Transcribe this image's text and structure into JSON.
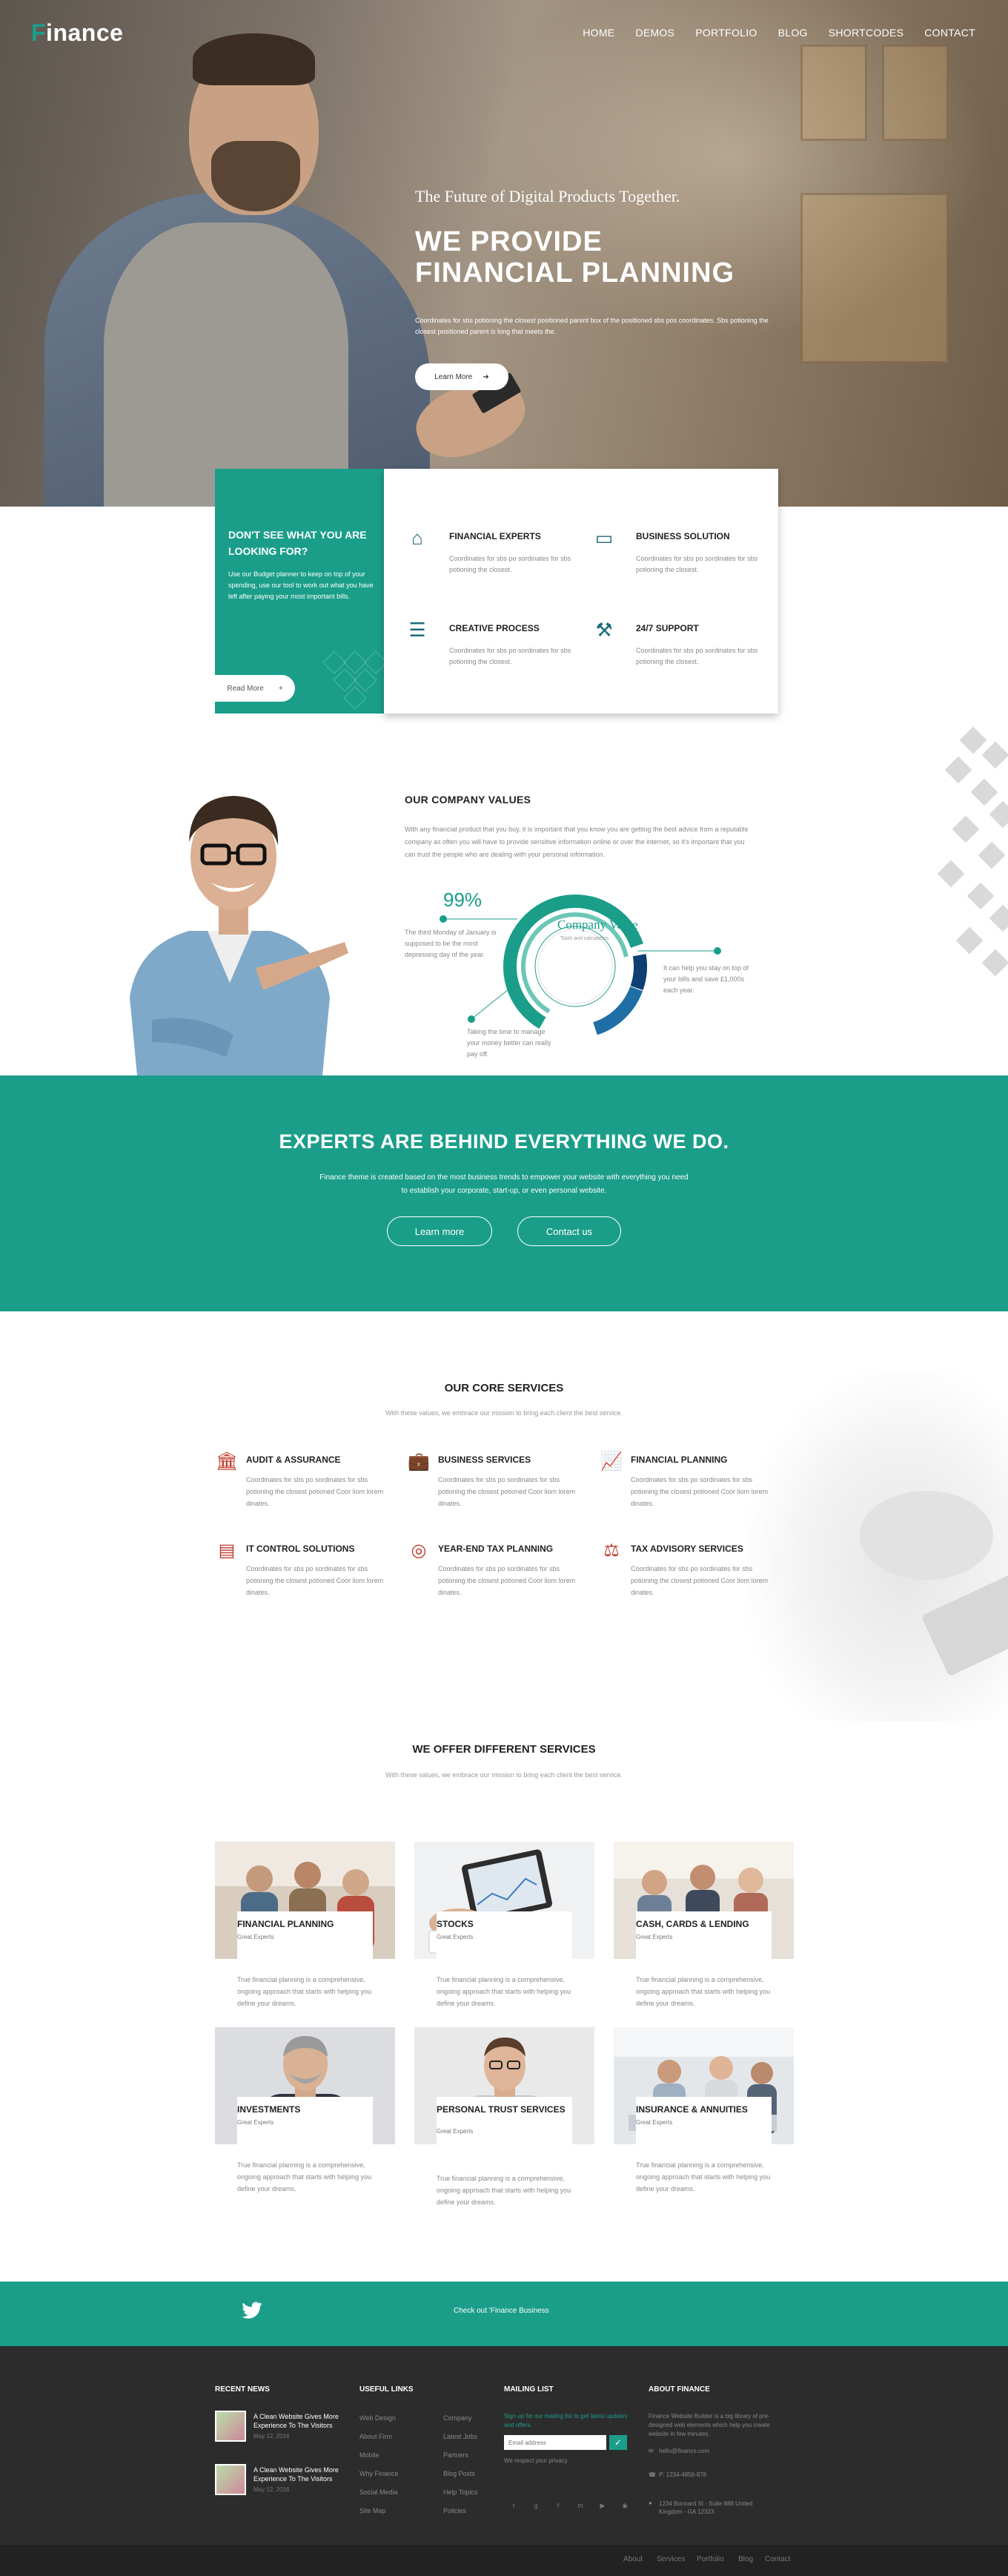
{
  "colors": {
    "accent": "#1a9e8a",
    "footer": "#2c2c2c"
  },
  "header": {
    "logo": "Finance",
    "nav": [
      "HOME",
      "DEMOS",
      "PORTFOLIO",
      "BLOG",
      "SHORTCODES",
      "CONTACT"
    ]
  },
  "hero": {
    "kicker": "The Future of Digital Products Together.",
    "title_line1": "WE PROVIDE",
    "title_line2": "FINANCIAL PLANNING",
    "text": "Coordinates for sbs potioning the closest positioned parent box of the positioned sbs pos coordinates. Sbs potioning the closest positioned parent is long that meets the.",
    "button": "Learn More"
  },
  "feature_box": {
    "title": "DON'T SEE WHAT YOU ARE LOOKING FOR?",
    "text": "Use our Budget planner to keep on top of your spending, use our tool to work out what you have left after paying your most important bills.",
    "button": "Read More",
    "items": [
      {
        "icon": "house-icon",
        "title": "FINANCIAL EXPERTS",
        "text": "Coordinates for sbs po sordinates for sbs potioning the closest."
      },
      {
        "icon": "business-icon",
        "title": "BUSINESS SOLUTION",
        "text": "Coordinates for sbs po sordinates for sbs potioning the closest."
      },
      {
        "icon": "sliders-icon",
        "title": "CREATIVE PROCESS",
        "text": "Coordinates for sbs po sordinates for sbs potioning the closest."
      },
      {
        "icon": "tools-icon",
        "title": "24/7 SUPPORT",
        "text": "Coordinates for sbs po sordinates for sbs potioning the closest."
      }
    ]
  },
  "values": {
    "title": "OUR COMPANY VALUES",
    "text": "With any financial product that you buy, it is important that you know you are getting the best advice from a reputable company as often you will have to provide sensitive information online or over the internet, so it's important that you can trust the people who are dealing with your personal information.",
    "percent": "99%",
    "chart_title": "Company Value",
    "chart_sub": "Tools and calculators",
    "label1": "The third Monday of January is supposed to be the most depressing day of the year.",
    "label2": "Taking the time to manage your money better can really pay off.",
    "label3": "It can help you stay on top of your bills and save £1,000s each year."
  },
  "experts": {
    "title": "EXPERTS ARE BEHIND EVERYTHING WE DO.",
    "text": "Finance theme is created based on the most business trends to empower your website with everything you need to establish your corporate, start-up, or even personal website.",
    "btn_learn": "Learn more",
    "btn_contact": "Contact us"
  },
  "core": {
    "title": "OUR CORE SERVICES",
    "subtitle": "With these values, we embrace our mission to bring each client the best service.",
    "items": [
      {
        "icon": "bank-icon",
        "title": "AUDIT & ASSURANCE",
        "text": "Coordinates for sbs po sordinates for sbs potioning the closest potioned Coor liom lorem dinates."
      },
      {
        "icon": "briefcase-icon",
        "title": "BUSINESS SERVICES",
        "text": "Coordinates for sbs po sordinates for sbs potioning the closest potioned Coor liom lorem dinates."
      },
      {
        "icon": "chart-icon",
        "title": "FINANCIAL PLANNING",
        "text": "Coordinates for sbs po sordinates for sbs potioning the closest potioned Coor liom lorem dinates."
      },
      {
        "icon": "board-icon",
        "title": "IT CONTROL SOLUTIONS",
        "text": "Coordinates for sbs po sordinates for sbs potioning the closest potioned Coor liom lorem dinates."
      },
      {
        "icon": "target-icon",
        "title": "YEAR-END TAX PLANNING",
        "text": "Coordinates for sbs po sordinates for sbs potioning the closest potioned Coor liom lorem dinates."
      },
      {
        "icon": "scale-icon",
        "title": "TAX ADVISORY SERVICES",
        "text": "Coordinates for sbs po sordinates for sbs potioning the closest potioned Coor liom lorem dinates."
      }
    ]
  },
  "offer": {
    "title": "WE OFFER DIFFERENT SERVICES",
    "subtitle": "With these values, we embrace our mission to bring each client the best service.",
    "cards": [
      {
        "title": "FINANCIAL PLANNING",
        "sub": "Great Experts",
        "text": "True financial planning is a comprehensive, ongoing approach that starts with helping you define your dreams."
      },
      {
        "title": "STOCKS",
        "sub": "Great Experts",
        "text": "True financial planning is a comprehensive, ongoing approach that starts with helping you define your dreams."
      },
      {
        "title": "CASH, CARDS & LENDING",
        "sub": "Great Experts",
        "text": "True financial planning is a comprehensive, ongoing approach that starts with helping you define your dreams."
      },
      {
        "title": "INVESTMENTS",
        "sub": "Great Experts",
        "text": "True financial planning is a comprehensive, ongoing approach that starts with helping you define your dreams."
      },
      {
        "title": "PERSONAL TRUST SERVICES",
        "sub": "Great Experts",
        "text": "True financial planning is a comprehensive, ongoing approach that starts with helping you define your dreams."
      },
      {
        "title": "INSURANCE & ANNUITIES",
        "sub": "Great Experts",
        "text": "True financial planning is a comprehensive, ongoing approach that starts with helping you define your dreams."
      }
    ]
  },
  "twitter": {
    "text": "Check out 'Finance Business"
  },
  "footer": {
    "recent_title": "RECENT NEWS",
    "news": [
      {
        "title": "A Clean Website Gives More Experience To The Visitors",
        "date": "May 12, 2016"
      },
      {
        "title": "A Clean Website Gives More Experience To The Visitors",
        "date": "May 12, 2016"
      }
    ],
    "useful_title": "USEFUL LINKS",
    "links_col1": [
      "Web Design",
      "About Firm",
      "Mobile",
      "Why Finance",
      "Social Media",
      "Site Map"
    ],
    "links_col2": [
      "Company",
      "Latest Jobs",
      "Partners",
      "Blog Posts",
      "Help Topics",
      "Policies"
    ],
    "mailing_title": "MAILING LIST",
    "mailing_text": "Sign up for our mailing list to get latest updates and offers.",
    "email_placeholder": "Email address",
    "privacy": "We respect your privacy",
    "about_title": "ABOUT FINANCE",
    "about_text": "Finance Website Builder is a big library of pre-designed web elements which help you create website in few minutes.",
    "email": "hello@finance.com",
    "phone": "P: 1234-4856-878",
    "address": "1234 Bonnard St - Suite 888 United Kingdom - GA 12323",
    "bottom_links": [
      "About",
      "Services",
      "Portfolio",
      "Blog",
      "Contact"
    ]
  }
}
